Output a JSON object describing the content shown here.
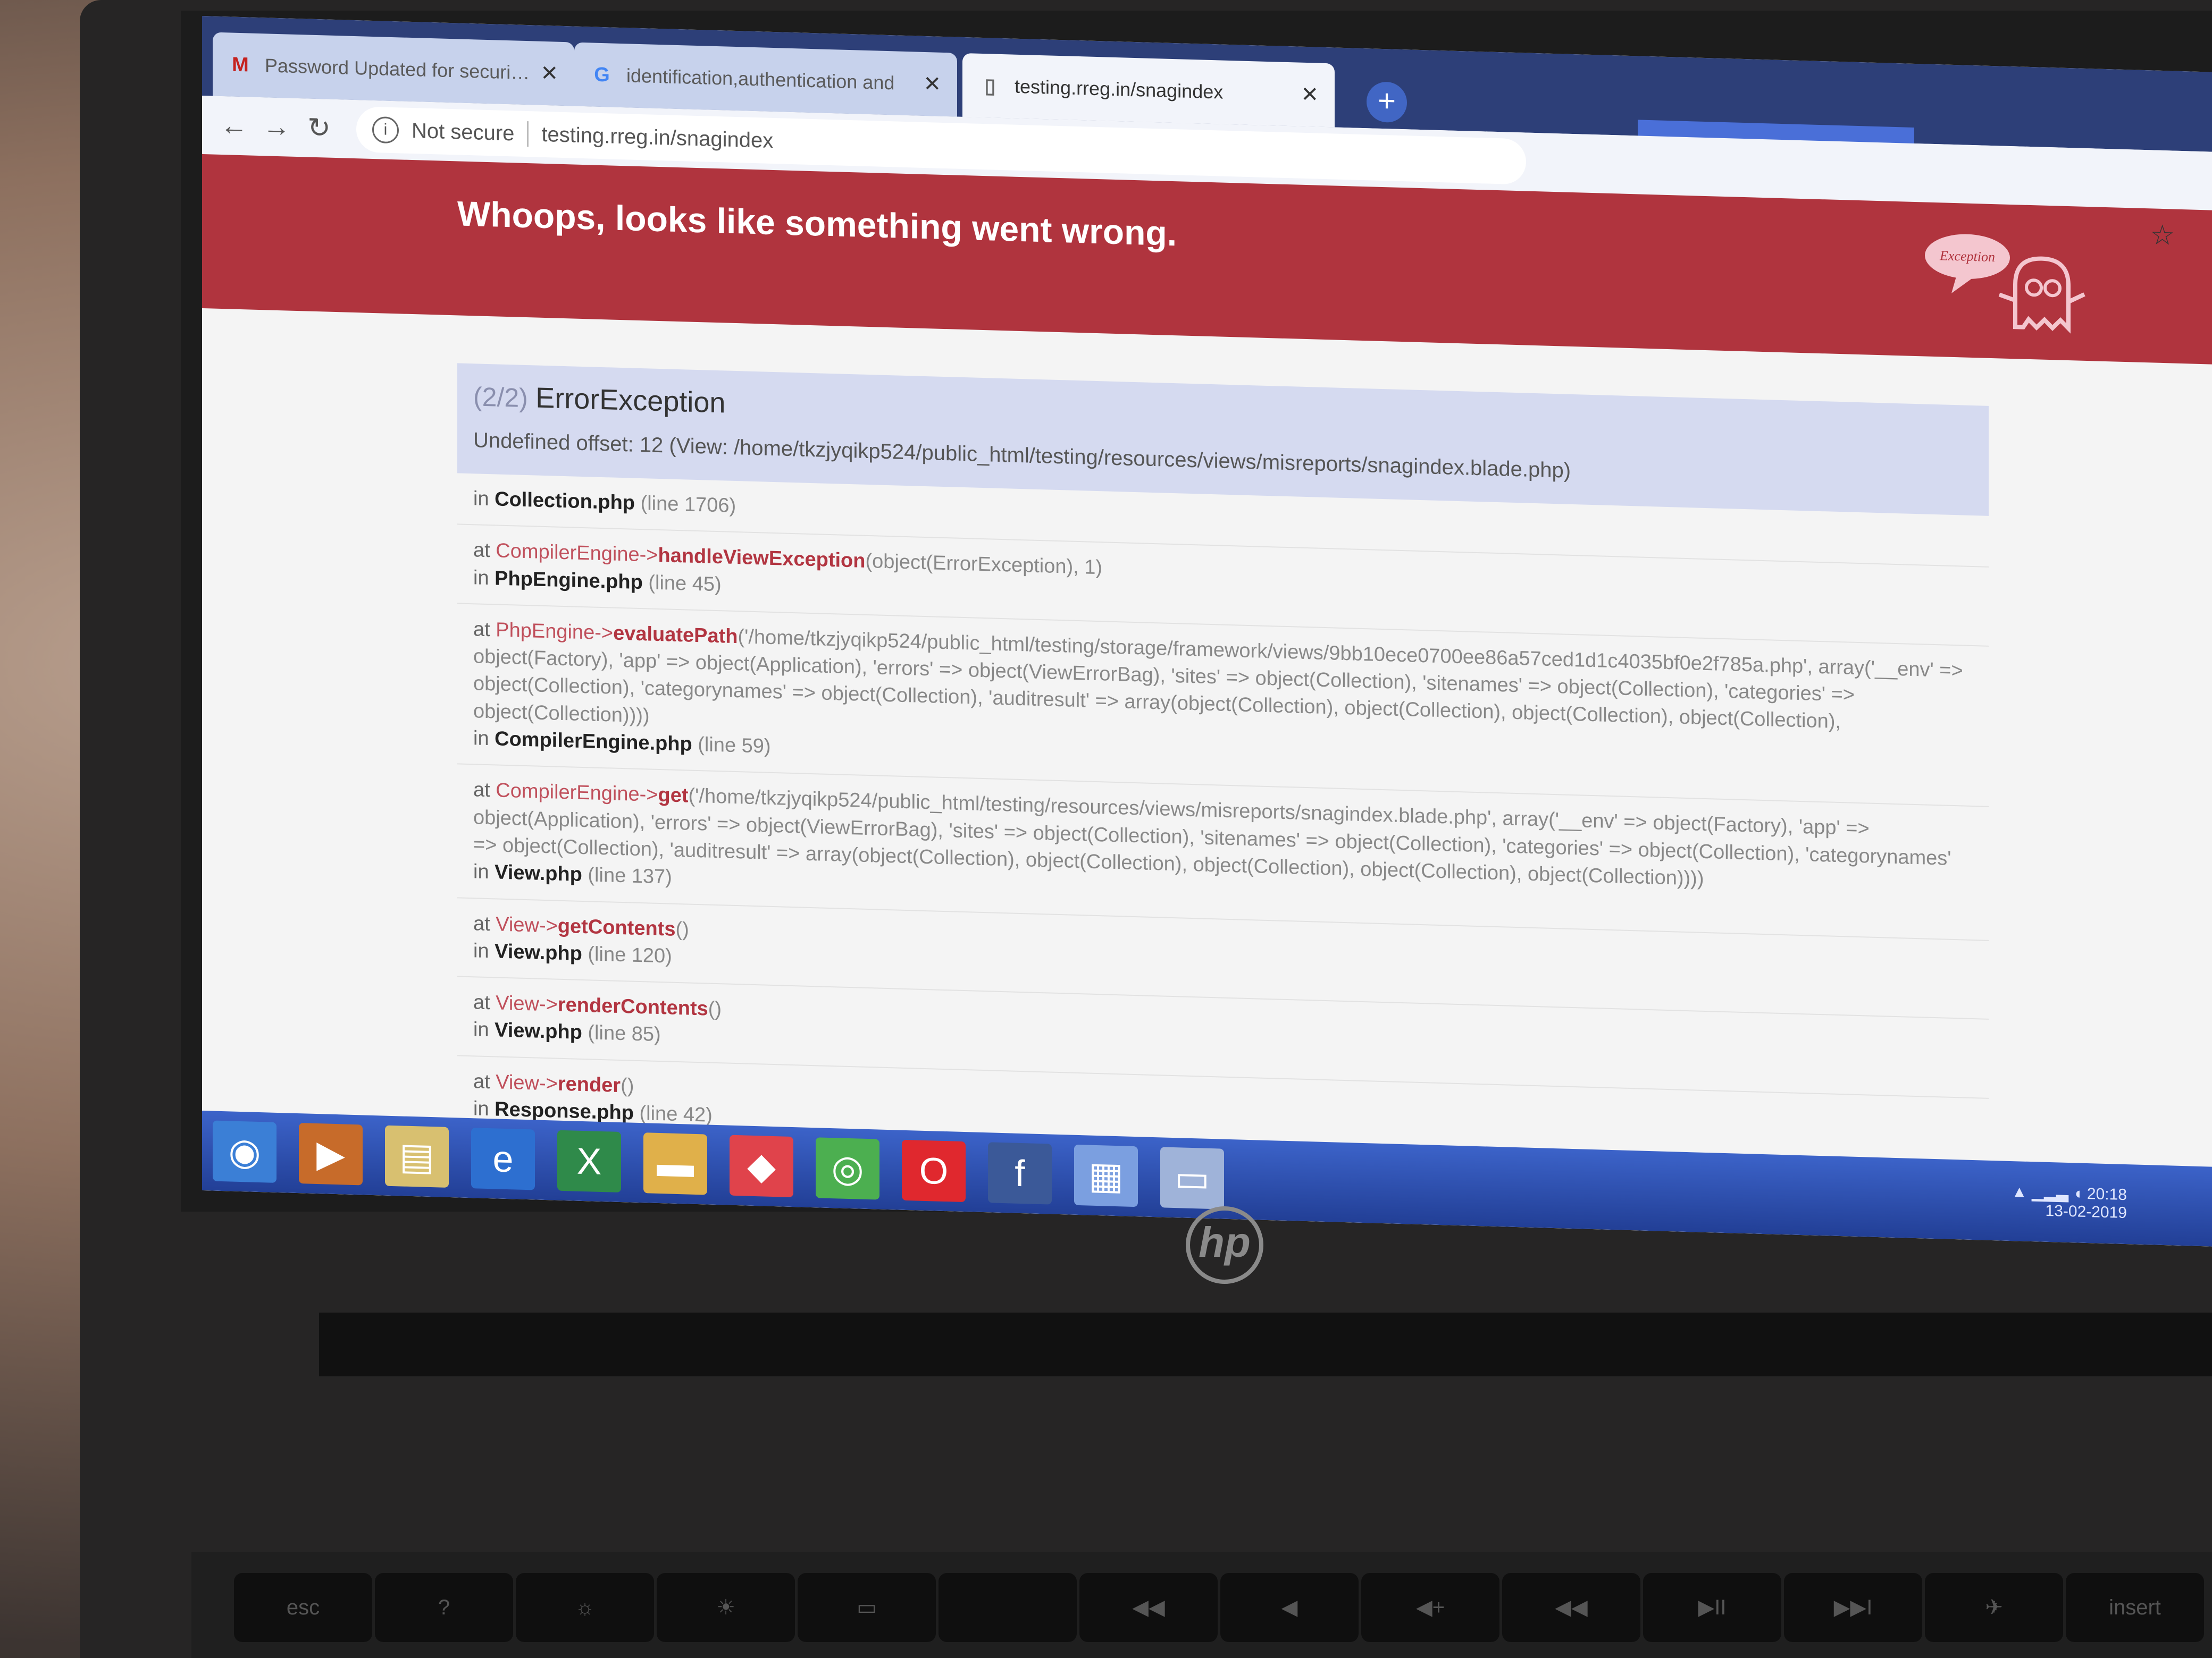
{
  "browser": {
    "tabs": [
      {
        "icon": "gmail-icon",
        "glyph": "M",
        "title": "Password Updated for security n"
      },
      {
        "icon": "google-icon",
        "glyph": "G",
        "title": "identification,authentication and"
      },
      {
        "icon": "page-icon",
        "glyph": "▯",
        "title": "testing.rreg.in/snagindex"
      }
    ],
    "close_glyph": "✕",
    "new_tab_glyph": "+",
    "back_glyph": "←",
    "forward_glyph": "→",
    "reload_glyph": "↻",
    "info_glyph": "i",
    "security_label": "Not secure",
    "url": "testing.rreg.in/snagindex",
    "star_glyph": "☆"
  },
  "page": {
    "banner_title": "Whoops, looks like something went wrong.",
    "mascot_label": "Exception",
    "exception": {
      "counter": "(2/2)",
      "name": "ErrorException",
      "message": "Undefined offset: 12 (View: /home/tkzjyqikp524/public_html/testing/resources/views/misreports/snagindex.blade.php)"
    },
    "frames": [
      {
        "at_prefix": "",
        "cls": "",
        "arrow": "",
        "fn": "",
        "args": "",
        "in_prefix": "in",
        "file": "Collection.php",
        "line": "(line 1706)"
      },
      {
        "at_prefix": "at",
        "cls": "CompilerEngine",
        "arrow": "->",
        "fn": "handleViewException",
        "args": "(object(ErrorException), 1)",
        "in_prefix": "in",
        "file": "PhpEngine.php",
        "line": "(line 45)"
      },
      {
        "at_prefix": "at",
        "cls": "PhpEngine",
        "arrow": "->",
        "fn": "evaluatePath",
        "args": "('/home/tkzjyqikp524/public_html/testing/storage/framework/views/9bb10ece0700ee86a57ced1d1c4035bf0e2f785a.php', array('__env' => object(Factory), 'app' => object(Application), 'errors' => object(ViewErrorBag), 'sites' => object(Collection), 'sitenames' => object(Collection), 'categories' => object(Collection), 'categorynames' => object(Collection), 'auditresult' => array(object(Collection), object(Collection), object(Collection), object(Collection), object(Collection))))",
        "in_prefix": "in",
        "file": "CompilerEngine.php",
        "line": "(line 59)"
      },
      {
        "at_prefix": "at",
        "cls": "CompilerEngine",
        "arrow": "->",
        "fn": "get",
        "args": "('/home/tkzjyqikp524/public_html/testing/resources/views/misreports/snagindex.blade.php', array('__env' => object(Factory), 'app' => object(Application), 'errors' => object(ViewErrorBag), 'sites' => object(Collection), 'sitenames' => object(Collection), 'categories' => object(Collection), 'categorynames' => object(Collection), 'auditresult' => array(object(Collection), object(Collection), object(Collection), object(Collection), object(Collection))))",
        "in_prefix": "in",
        "file": "View.php",
        "line": "(line 137)"
      },
      {
        "at_prefix": "at",
        "cls": "View",
        "arrow": "->",
        "fn": "getContents",
        "args": "()",
        "in_prefix": "in",
        "file": "View.php",
        "line": "(line 120)"
      },
      {
        "at_prefix": "at",
        "cls": "View",
        "arrow": "->",
        "fn": "renderContents",
        "args": "()",
        "in_prefix": "in",
        "file": "View.php",
        "line": "(line 85)"
      },
      {
        "at_prefix": "at",
        "cls": "View",
        "arrow": "->",
        "fn": "render",
        "args": "()",
        "in_prefix": "in",
        "file": "Response.php",
        "line": "(line 42)"
      }
    ]
  },
  "taskbar": {
    "icons": [
      {
        "name": "start-button-icon",
        "glyph": "◉",
        "color": "#3b7fd6"
      },
      {
        "name": "media-player-icon",
        "glyph": "▶",
        "color": "#c76b2a"
      },
      {
        "name": "file-explorer-icon",
        "glyph": "▤",
        "color": "#d8c070"
      },
      {
        "name": "internet-explorer-icon",
        "glyph": "e",
        "color": "#2d6fd0"
      },
      {
        "name": "excel-icon",
        "glyph": "X",
        "color": "#2f8a4a"
      },
      {
        "name": "folder-icon",
        "glyph": "▬",
        "color": "#e0b04a"
      },
      {
        "name": "anydesk-icon",
        "glyph": "◆",
        "color": "#e0434b"
      },
      {
        "name": "chrome-icon",
        "glyph": "◎",
        "color": "#4caf50"
      },
      {
        "name": "opera-icon",
        "glyph": "O",
        "color": "#e0282e"
      },
      {
        "name": "facebook-icon",
        "glyph": "f",
        "color": "#3b5998"
      },
      {
        "name": "document-icon",
        "glyph": "▦",
        "color": "#7b9fe0"
      },
      {
        "name": "app-window-icon",
        "glyph": "▭",
        "color": "#9fb3d9"
      }
    ],
    "tray_up_glyph": "▲",
    "tray_signal_glyph": "▁▂▃",
    "tray_volume_glyph": "◖",
    "clock_time": "20:18",
    "clock_date": "13-02-2019"
  },
  "laptop": {
    "brand": "hp",
    "keys": [
      "esc",
      "?",
      "☼",
      "☀",
      "▭",
      "",
      "◀◀",
      "◀",
      "◀+",
      "◀◀",
      "▶II",
      "▶▶I",
      "✈",
      "insert"
    ]
  },
  "colors": {
    "banner": "#b0343e",
    "function_name": "#b23541",
    "class_name": "#c0505c",
    "exception_header": "#d5daf0",
    "taskbar": "#2f52b6"
  }
}
